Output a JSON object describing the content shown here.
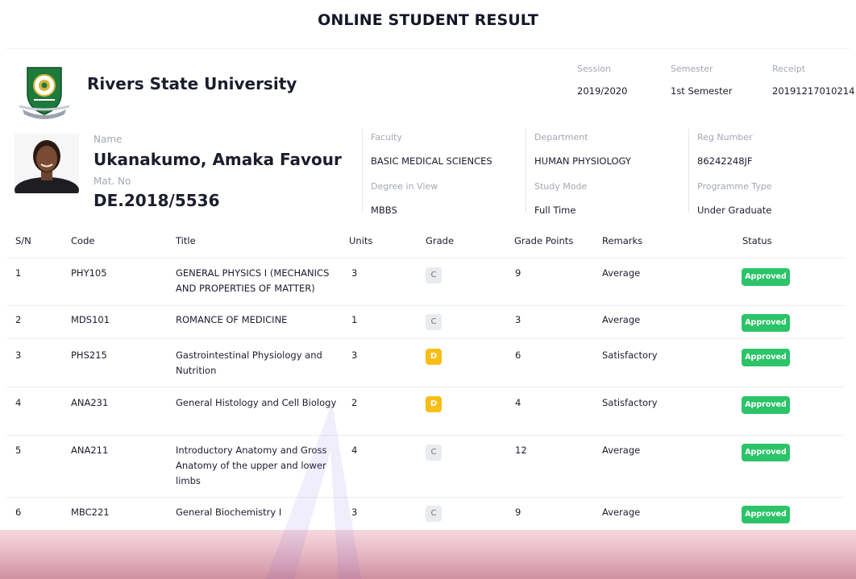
{
  "page": {
    "title": "ONLINE STUDENT RESULT"
  },
  "institution": {
    "name": "Rivers State University",
    "session_label": "Session",
    "session": "2019/2020",
    "semester_label": "Semester",
    "semester": "1st Semester",
    "receipt_label": "Receipt",
    "receipt": "20191217010214"
  },
  "student": {
    "name_label": "Name",
    "name": "Ukanakumo, Amaka Favour",
    "matno_label": "Mat. No",
    "matno": "DE.2018/5536",
    "faculty_label": "Faculty",
    "faculty": "BASIC MEDICAL SCIENCES",
    "degree_label": "Degree in View",
    "degree": "MBBS",
    "department_label": "Department",
    "department": "HUMAN PHYSIOLOGY",
    "mode_label": "Study Mode",
    "mode": "Full Time",
    "reg_label": "Reg Number",
    "reg": "86242248JF",
    "prog_label": "Programme Type",
    "prog": "Under Graduate"
  },
  "table": {
    "headers": [
      "S/N",
      "Code",
      "Title",
      "Units",
      "Grade",
      "Grade Points",
      "Remarks",
      "Status"
    ],
    "rows": [
      {
        "sn": "1",
        "code": "PHY105",
        "title": "GENERAL PHYSICS I (MECHANICS AND PROPERTIES OF MATTER)",
        "units": "3",
        "grade": "C",
        "points": "9",
        "remarks": "Average",
        "status": "Approved"
      },
      {
        "sn": "2",
        "code": "MDS101",
        "title": "ROMANCE OF MEDICINE",
        "units": "1",
        "grade": "C",
        "points": "3",
        "remarks": "Average",
        "status": "Approved"
      },
      {
        "sn": "3",
        "code": "PHS215",
        "title": "Gastrointestinal Physiology and Nutrition",
        "units": "3",
        "grade": "D",
        "points": "6",
        "remarks": "Satisfactory",
        "status": "Approved"
      },
      {
        "sn": "4",
        "code": "ANA231",
        "title": "General Histology and Cell Biology",
        "units": "2",
        "grade": "D",
        "points": "4",
        "remarks": "Satisfactory",
        "status": "Approved"
      },
      {
        "sn": "5",
        "code": "ANA211",
        "title": "Introductory Anatomy and Gross Anatomy of the upper and lower limbs",
        "units": "4",
        "grade": "C",
        "points": "12",
        "remarks": "Average",
        "status": "Approved"
      },
      {
        "sn": "6",
        "code": "MBC221",
        "title": "General Biochemistry I",
        "units": "3",
        "grade": "C",
        "points": "9",
        "remarks": "Average",
        "status": "Approved"
      }
    ]
  },
  "colors": {
    "approved": "#2cc468",
    "grade_d": "#f7be16",
    "grade_c_bg": "#e9ebef"
  },
  "icons": {
    "logo": "university-crest-icon",
    "photo": "student-avatar"
  }
}
